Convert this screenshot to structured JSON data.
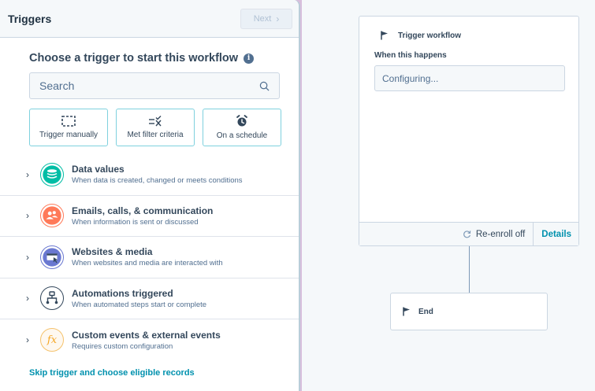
{
  "panel": {
    "title": "Triggers",
    "next_label": "Next",
    "heading": "Choose a trigger to start this workflow",
    "search_placeholder": "Search",
    "quick_triggers": [
      {
        "label": "Trigger manually",
        "icon": "dashed-square-icon"
      },
      {
        "label": "Met filter criteria",
        "icon": "filter-criteria-icon"
      },
      {
        "label": "On a schedule",
        "icon": "alarm-clock-icon"
      }
    ],
    "categories": [
      {
        "title": "Data values",
        "desc": "When data is created, changed or meets conditions",
        "icon": "database-icon",
        "color": "#00bda5"
      },
      {
        "title": "Emails, calls, & communication",
        "desc": "When information is sent or discussed",
        "icon": "users-icon",
        "color": "#ff7a59"
      },
      {
        "title": "Websites & media",
        "desc": "When websites and media are interacted with",
        "icon": "browser-cursor-icon",
        "color": "#6a78d1"
      },
      {
        "title": "Automations triggered",
        "desc": "When automated steps start or complete",
        "icon": "workflow-icon",
        "color": "#33475b"
      },
      {
        "title": "Custom events & external events",
        "desc": "Requires custom configuration",
        "icon": "function-icon",
        "color": "#f5c26b"
      }
    ],
    "skip_link": "Skip trigger and choose eligible records"
  },
  "canvas": {
    "trigger_card": {
      "title": "Trigger workflow",
      "label": "When this happens",
      "field_value": "Configuring...",
      "reenroll_label": "Re-enroll off",
      "details_label": "Details"
    },
    "end_card": {
      "label": "End"
    }
  },
  "colors": {
    "accent_link": "#0091ae",
    "card_border": "#7fd1de",
    "backdrop": "#d8bfdc"
  }
}
